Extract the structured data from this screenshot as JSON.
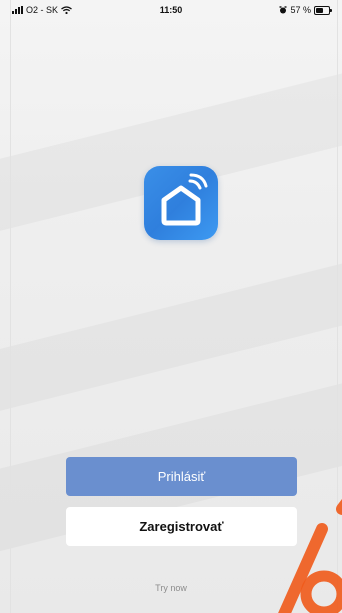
{
  "status_bar": {
    "carrier": "O2 - SK",
    "time": "11:50",
    "battery_text": "57 %",
    "battery_level": 0.57
  },
  "app_icon": {
    "icon": "smart-home-icon",
    "color": "#3a8fe8"
  },
  "buttons": {
    "login_label": "Prihlásiť",
    "register_label": "Zaregistrovať"
  },
  "try_now_label": "Try now",
  "colors": {
    "primary": "#6a8fcf",
    "watermark": "#f05a1a"
  }
}
